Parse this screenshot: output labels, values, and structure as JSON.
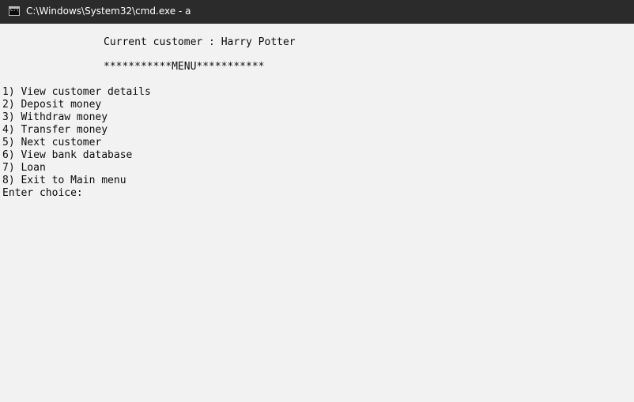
{
  "window": {
    "title": "C:\\Windows\\System32\\cmd.exe - a"
  },
  "console": {
    "customer_line": "Current customer : Harry Potter",
    "menu_header": "***********MENU***********",
    "menu_items": [
      "1) View customer details",
      "2) Deposit money",
      "3) Withdraw money",
      "4) Transfer money",
      "5) Next customer",
      "6) View bank database",
      "7) Loan",
      "8) Exit to Main menu"
    ],
    "prompt": "Enter choice:"
  },
  "colors": {
    "titlebar_bg": "#2b2b2b",
    "console_bg": "#f2f2f2",
    "text": "#0c0c0c"
  },
  "icons": {
    "title_icon": "cmd-icon"
  }
}
